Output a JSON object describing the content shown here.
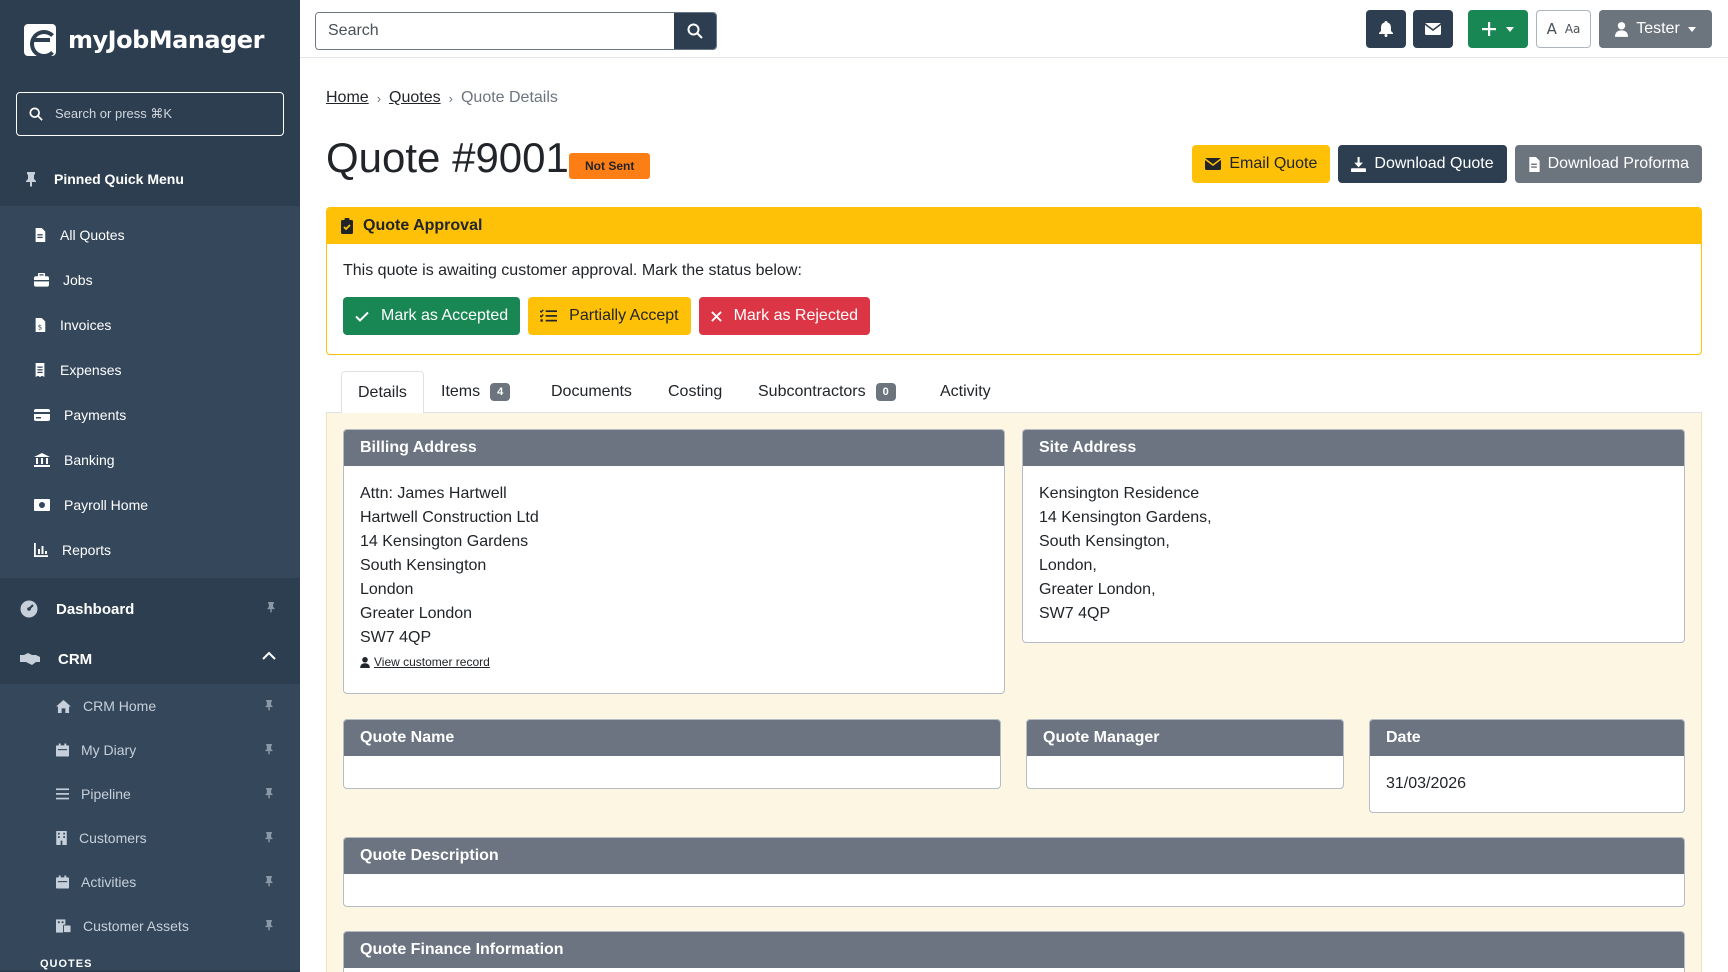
{
  "app": {
    "name": "myJobManager"
  },
  "sidebar": {
    "search_placeholder": "Search or press ⌘K",
    "pinned_title": "Pinned Quick Menu",
    "pinned_items": [
      {
        "label": "All Quotes",
        "icon": "file-icon"
      },
      {
        "label": "Jobs",
        "icon": "briefcase-icon"
      },
      {
        "label": "Invoices",
        "icon": "invoice-icon"
      },
      {
        "label": "Expenses",
        "icon": "receipt-icon"
      },
      {
        "label": "Payments",
        "icon": "card-icon"
      },
      {
        "label": "Banking",
        "icon": "bank-icon"
      },
      {
        "label": "Payroll Home",
        "icon": "money-icon"
      },
      {
        "label": "Reports",
        "icon": "chart-icon"
      }
    ],
    "sections": {
      "dashboard": "Dashboard",
      "crm": "CRM"
    },
    "crm_items": [
      {
        "label": "CRM Home",
        "icon": "home-icon"
      },
      {
        "label": "My Diary",
        "icon": "calendar-icon"
      },
      {
        "label": "Pipeline",
        "icon": "list-icon"
      },
      {
        "label": "Customers",
        "icon": "building-icon"
      },
      {
        "label": "Activities",
        "icon": "calendar-icon"
      },
      {
        "label": "Customer Assets",
        "icon": "assets-icon"
      }
    ],
    "caption": "QUOTES"
  },
  "topbar": {
    "search_placeholder": "Search",
    "font_toggle_a": "A",
    "font_toggle_aa": "Aa",
    "user": "Tester"
  },
  "breadcrumb": {
    "home": "Home",
    "quotes": "Quotes",
    "current": "Quote Details"
  },
  "quote": {
    "title": "Quote #9001",
    "status": "Not Sent"
  },
  "actions": {
    "email": "Email Quote",
    "download": "Download Quote",
    "proforma": "Download Proforma"
  },
  "approval": {
    "title": "Quote Approval",
    "text": "This quote is awaiting customer approval. Mark the status below:",
    "accept": "Mark as Accepted",
    "partial": "Partially Accept",
    "reject": "Mark as Rejected"
  },
  "tabs": {
    "details": "Details",
    "items": "Items",
    "items_count": "4",
    "documents": "Documents",
    "costing": "Costing",
    "subcontractors": "Subcontractors",
    "subcontractors_count": "0",
    "activity": "Activity"
  },
  "billing": {
    "title": "Billing Address",
    "lines": [
      "Attn: James Hartwell",
      "Hartwell Construction Ltd",
      "14 Kensington Gardens",
      "South Kensington",
      "London",
      "Greater London",
      "SW7 4QP"
    ],
    "link": "View customer record"
  },
  "site": {
    "title": "Site Address",
    "lines": [
      "Kensington Residence",
      "14 Kensington Gardens,",
      "South Kensington,",
      "London,",
      "Greater London,",
      "SW7 4QP"
    ]
  },
  "fields": {
    "quote_name": "Quote Name",
    "quote_manager": "Quote Manager",
    "date_label": "Date",
    "date_value": "31/03/2026",
    "description": "Quote Description",
    "finance": "Quote Finance Information"
  },
  "colors": {
    "sidebar": "#2d3e50",
    "warning": "#ffc107",
    "success": "#198754",
    "danger": "#dc3545",
    "orange": "#fd7e14"
  }
}
